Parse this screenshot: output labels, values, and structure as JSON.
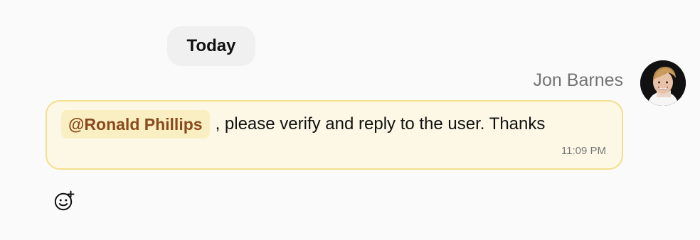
{
  "date_divider": {
    "label": "Today"
  },
  "message": {
    "sender": "Jon Barnes",
    "mention": "@Ronald Phillips",
    "text": ", please verify and reply to the user. Thanks",
    "time": "11:09 PM",
    "avatar_icon": "user-photo-avatar",
    "reaction_icon": "emoji-add-icon"
  },
  "colors": {
    "bubble_bg": "#fdf8e6",
    "bubble_border": "#f2df8d",
    "mention_bg": "#faefc2",
    "mention_text": "#8a4a1d"
  }
}
